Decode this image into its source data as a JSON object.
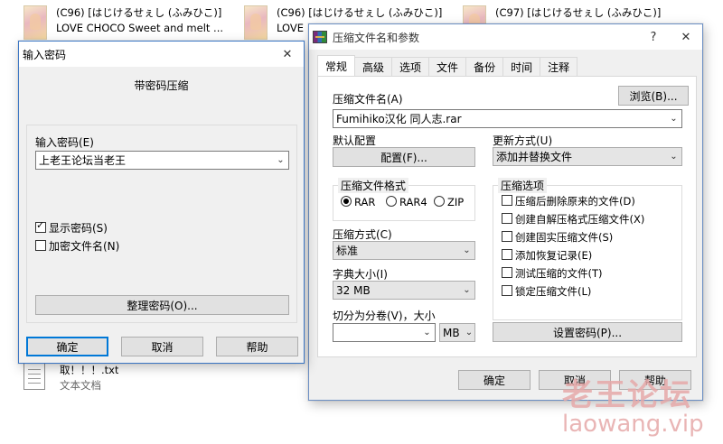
{
  "explorer": {
    "files": [
      {
        "line1": "(C96) [はじけるせぇし (ふみひこ)]",
        "line2": "LOVE CHOCO Sweet and melt ..."
      },
      {
        "line1": "(C96) [はじけるせぇし (ふみひこ)]",
        "line2": "LOVE"
      },
      {
        "line1": "(C97) [はじけるせぇし (ふみひこ)]",
        "line2": ""
      }
    ],
    "txt_file": {
      "name": "取！！！.txt",
      "type": "文本文档"
    }
  },
  "main_dialog": {
    "title": "压缩文件名和参数",
    "help_glyph": "?",
    "close_glyph": "✕",
    "tabs": [
      "常规",
      "高级",
      "选项",
      "文件",
      "备份",
      "时间",
      "注释"
    ],
    "active_tab": 0,
    "archive_name_label": "压缩文件名(A)",
    "browse_button": "浏览(B)...",
    "archive_name_value": "Fumihiko汉化 同人志.rar",
    "default_profile_label": "默认配置",
    "profile_button": "配置(F)...",
    "update_mode_label": "更新方式(U)",
    "update_mode_value": "添加并替换文件",
    "format_group": "压缩文件格式",
    "formats": [
      {
        "label": "RAR",
        "selected": true
      },
      {
        "label": "RAR4",
        "selected": false
      },
      {
        "label": "ZIP",
        "selected": false
      }
    ],
    "method_label": "压缩方式(C)",
    "method_value": "标准",
    "dict_label": "字典大小(I)",
    "dict_value": "32 MB",
    "split_label": "切分为分卷(V)，大小",
    "split_value": "",
    "split_unit": "MB",
    "options_group": "压缩选项",
    "options": [
      {
        "label": "压缩后删除原来的文件(D)",
        "checked": false
      },
      {
        "label": "创建自解压格式压缩文件(X)",
        "checked": false
      },
      {
        "label": "创建固实压缩文件(S)",
        "checked": false
      },
      {
        "label": "添加恢复记录(E)",
        "checked": false
      },
      {
        "label": "测试压缩的文件(T)",
        "checked": false
      },
      {
        "label": "锁定压缩文件(L)",
        "checked": false
      }
    ],
    "set_password_button": "设置密码(P)...",
    "ok_button": "确定",
    "cancel_button": "取消",
    "help_button": "帮助"
  },
  "password_dialog": {
    "title": "输入密码",
    "close_glyph": "✕",
    "heading": "带密码压缩",
    "enter_label": "输入密码(E)",
    "password_value": "上老王论坛当老王",
    "show_password_label": "显示密码(S)",
    "show_password_checked": true,
    "encrypt_names_label": "加密文件名(N)",
    "encrypt_names_checked": false,
    "organize_button": "整理密码(O)...",
    "ok_button": "确定",
    "cancel_button": "取消",
    "help_button": "帮助"
  },
  "watermark": {
    "line1": "老王论坛",
    "line2": "laowang.vip"
  },
  "icons": {
    "dropdown": "chevron-down-icon",
    "rar": "winrar-icon",
    "txt": "text-file-icon"
  },
  "colors": {
    "accent": "#0078d7",
    "dialog_bg": "#f0f0f0",
    "watermark": "#e6a9a9"
  }
}
